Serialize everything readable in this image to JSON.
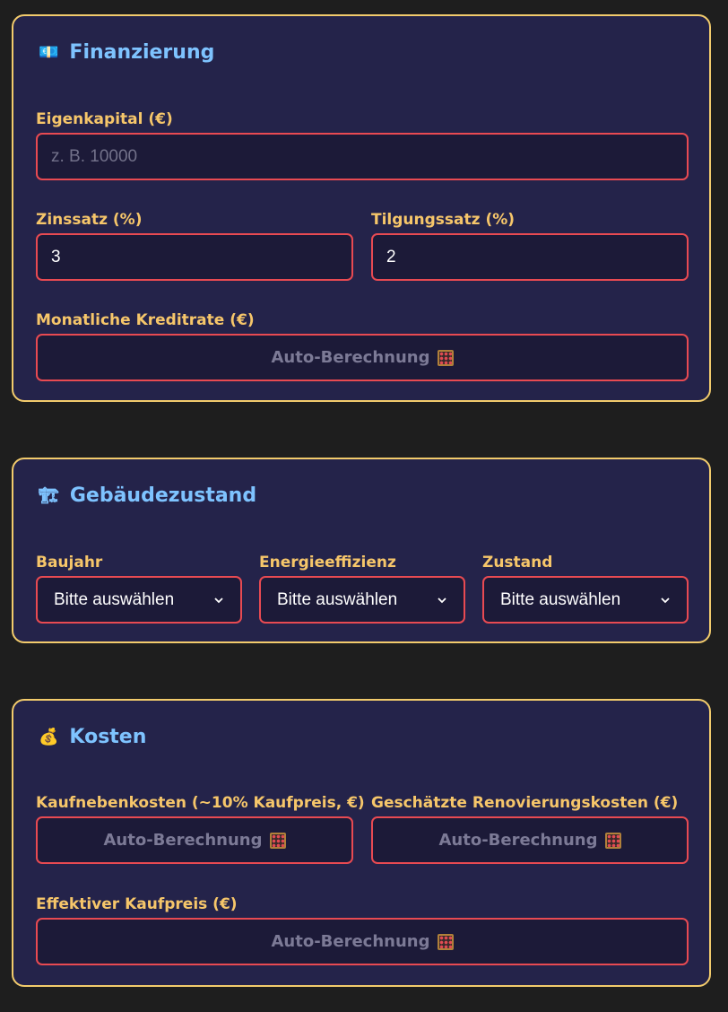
{
  "finanzierung": {
    "icon": "money-icon",
    "icon_glyph": "💶",
    "title": "Finanzierung",
    "eigenkapital": {
      "label": "Eigenkapital (€)",
      "value": "",
      "placeholder": "z. B. 10000"
    },
    "zinssatz": {
      "label": "Zinssatz (%)",
      "value": "3"
    },
    "tilgungssatz": {
      "label": "Tilgungssatz (%)",
      "value": "2"
    },
    "kreditrate": {
      "label": "Monatliche Kreditrate (€)",
      "value": "Auto-Berechnung"
    }
  },
  "gebaeude": {
    "icon": "construction-crane-icon",
    "icon_glyph": "🏗",
    "title": "Gebäudezustand",
    "baujahr": {
      "label": "Baujahr",
      "value": "Bitte auswählen"
    },
    "energie": {
      "label": "Energieeffizienz",
      "value": "Bitte auswählen"
    },
    "zustand": {
      "label": "Zustand",
      "value": "Bitte auswählen"
    }
  },
  "kosten": {
    "icon": "money-bag-icon",
    "icon_glyph": "💰",
    "title": "Kosten",
    "nebenkosten": {
      "label": "Kaufnebenkosten (~10% Kaufpreis, €)",
      "value": "Auto-Berechnung"
    },
    "renovierung": {
      "label": "Geschätzte Renovierungskosten (€)",
      "value": "Auto-Berechnung"
    },
    "effektiv": {
      "label": "Effektiver Kaufpreis (€)",
      "value": "Auto-Berechnung"
    }
  },
  "colors": {
    "background": "#1e1e1e",
    "card": "#24234a",
    "card_border": "#f2cb6c",
    "field_border": "#e84a52",
    "title": "#7ec3ff",
    "label": "#f6c66a"
  }
}
